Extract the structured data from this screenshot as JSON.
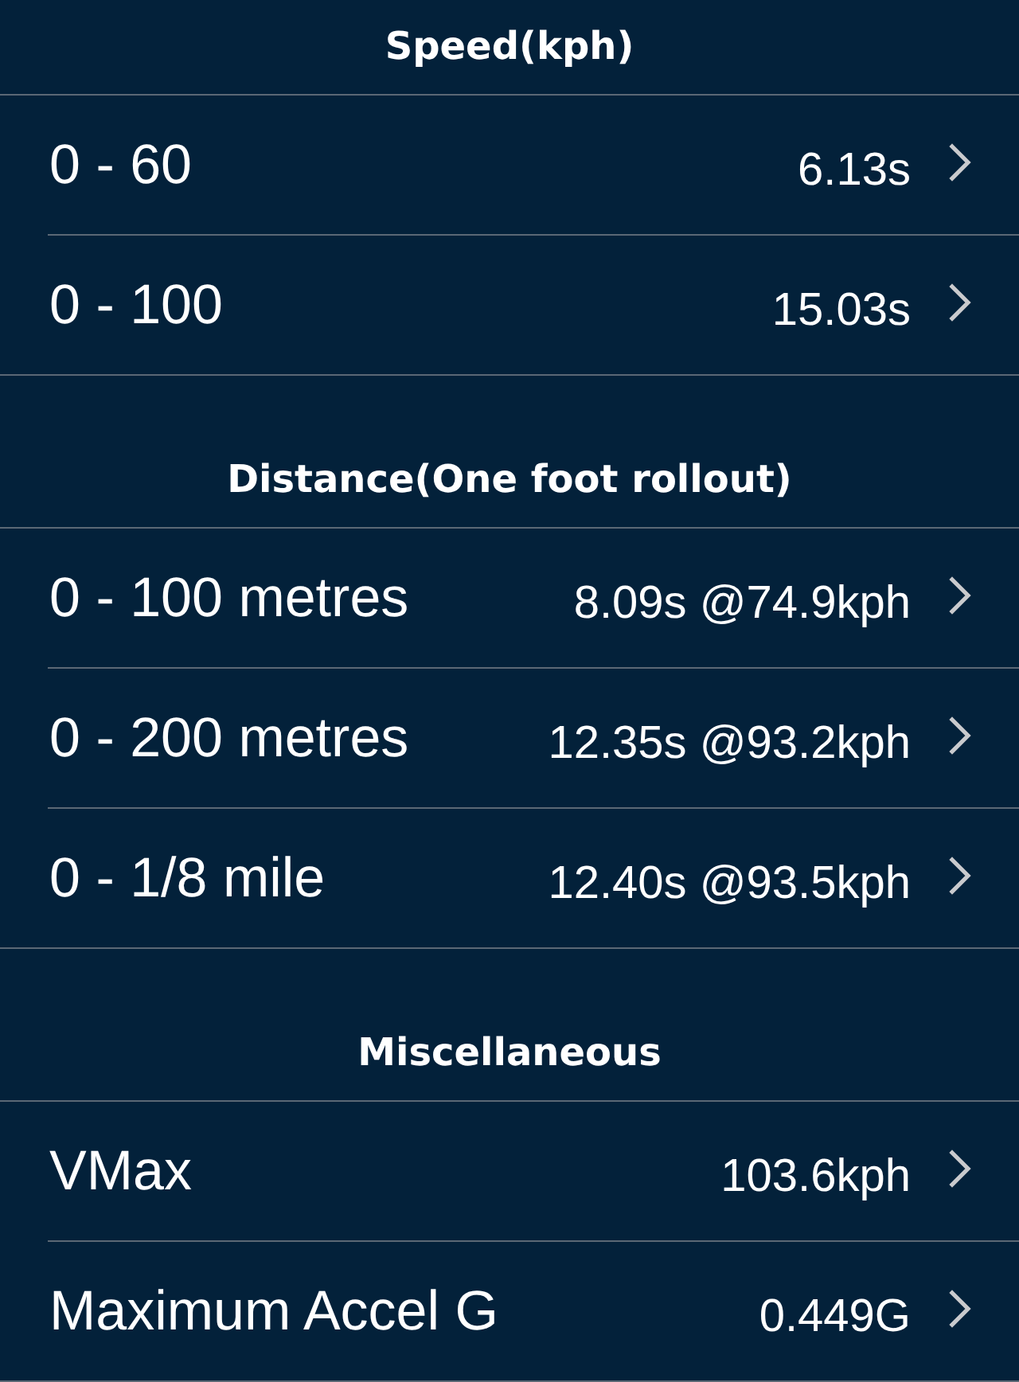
{
  "sections": [
    {
      "title": "Speed(kph)",
      "rows": [
        {
          "label": "0 - 60",
          "value": "6.13s"
        },
        {
          "label": "0 - 100",
          "value": "15.03s"
        }
      ]
    },
    {
      "title": "Distance(One foot rollout)",
      "rows": [
        {
          "label": "0 - 100 metres",
          "value": "8.09s @74.9kph"
        },
        {
          "label": "0 - 200 metres",
          "value": "12.35s @93.2kph"
        },
        {
          "label": "0 - 1/8 mile",
          "value": "12.40s @93.5kph"
        }
      ]
    },
    {
      "title": "Miscellaneous",
      "rows": [
        {
          "label": "VMax",
          "value": "103.6kph"
        },
        {
          "label": "Maximum Accel G",
          "value": "0.449G"
        }
      ]
    }
  ]
}
